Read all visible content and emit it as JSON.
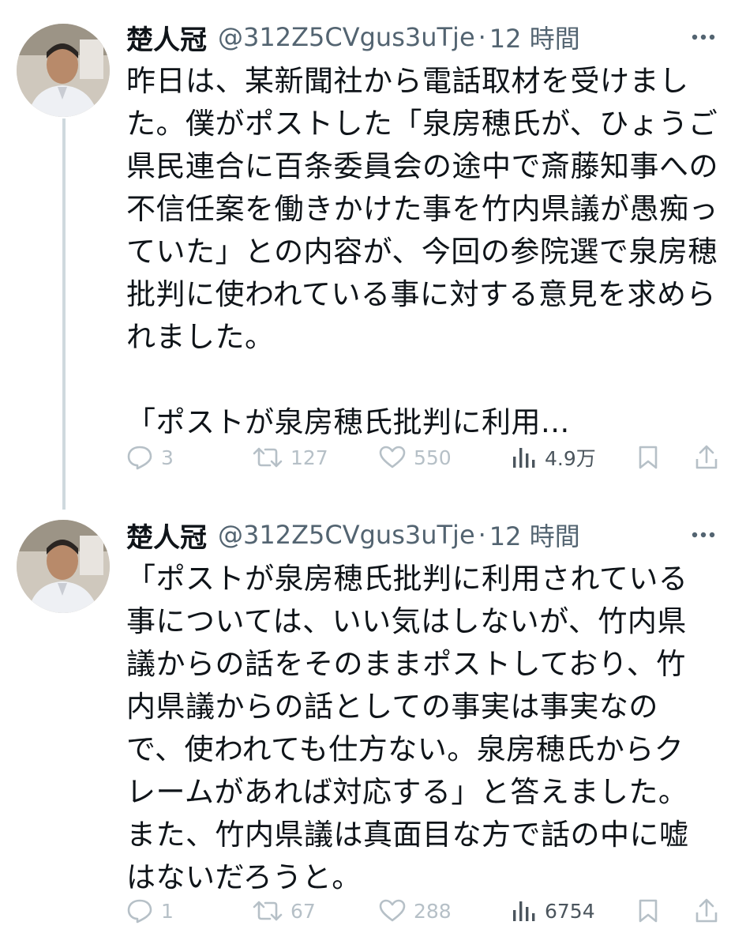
{
  "tweets": [
    {
      "display_name": "楚人冠",
      "handle": "@312Z5CVgus3uTje",
      "separator": "·",
      "time": "12 時間",
      "text": "昨日は、某新聞社から電話取材を受けまし\nた。僕がポストした「泉房穂氏が、ひょうご\n県民連合に百条委員会の途中で斎藤知事への\n不信任案を働きかけた事を竹内県議が愚痴っ\nていた」との内容が、今回の参院選で泉房穂\n批判に使われている事に対する意見を求めら\nれました。\n\n「ポストが泉房穂氏批判に利用...",
      "replies": "3",
      "retweets": "127",
      "likes": "550",
      "views": "4.9万"
    },
    {
      "display_name": "楚人冠",
      "handle": "@312Z5CVgus3uTje",
      "separator": "·",
      "time": "12 時間",
      "text": "「ポストが泉房穂氏批判に利用されている\n事については、いい気はしないが、竹内県\n議からの話をそのままポストしており、竹\n内県議からの話としての事実は事実なの\nで、使われても仕方ない。泉房穂氏からク\nレームがあれば対応する」と答えました。\nまた、竹内県議は真面目な方で話の中に嘘\nはないだろうと。",
      "replies": "1",
      "retweets": "67",
      "likes": "288",
      "views": "6754"
    }
  ],
  "icons": {
    "more": "more-dots-icon",
    "reply": "reply-bubble-icon",
    "retweet": "retweet-icon",
    "like": "heart-icon",
    "views": "views-bar-chart-icon",
    "bookmark": "bookmark-icon",
    "share": "share-upload-icon"
  },
  "colors": {
    "text": "#0f1419",
    "secondary": "#536471",
    "faded_action": "#b6c0c7",
    "thread_line": "#cfd9de"
  }
}
